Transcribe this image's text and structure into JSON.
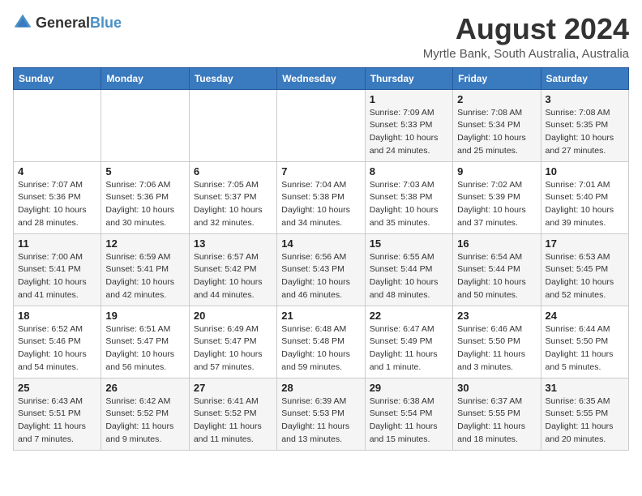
{
  "logo": {
    "general": "General",
    "blue": "Blue"
  },
  "title": "August 2024",
  "subtitle": "Myrtle Bank, South Australia, Australia",
  "days_header": [
    "Sunday",
    "Monday",
    "Tuesday",
    "Wednesday",
    "Thursday",
    "Friday",
    "Saturday"
  ],
  "weeks": [
    [
      {
        "day": "",
        "info": ""
      },
      {
        "day": "",
        "info": ""
      },
      {
        "day": "",
        "info": ""
      },
      {
        "day": "",
        "info": ""
      },
      {
        "day": "1",
        "info": "Sunrise: 7:09 AM\nSunset: 5:33 PM\nDaylight: 10 hours\nand 24 minutes."
      },
      {
        "day": "2",
        "info": "Sunrise: 7:08 AM\nSunset: 5:34 PM\nDaylight: 10 hours\nand 25 minutes."
      },
      {
        "day": "3",
        "info": "Sunrise: 7:08 AM\nSunset: 5:35 PM\nDaylight: 10 hours\nand 27 minutes."
      }
    ],
    [
      {
        "day": "4",
        "info": "Sunrise: 7:07 AM\nSunset: 5:36 PM\nDaylight: 10 hours\nand 28 minutes."
      },
      {
        "day": "5",
        "info": "Sunrise: 7:06 AM\nSunset: 5:36 PM\nDaylight: 10 hours\nand 30 minutes."
      },
      {
        "day": "6",
        "info": "Sunrise: 7:05 AM\nSunset: 5:37 PM\nDaylight: 10 hours\nand 32 minutes."
      },
      {
        "day": "7",
        "info": "Sunrise: 7:04 AM\nSunset: 5:38 PM\nDaylight: 10 hours\nand 34 minutes."
      },
      {
        "day": "8",
        "info": "Sunrise: 7:03 AM\nSunset: 5:38 PM\nDaylight: 10 hours\nand 35 minutes."
      },
      {
        "day": "9",
        "info": "Sunrise: 7:02 AM\nSunset: 5:39 PM\nDaylight: 10 hours\nand 37 minutes."
      },
      {
        "day": "10",
        "info": "Sunrise: 7:01 AM\nSunset: 5:40 PM\nDaylight: 10 hours\nand 39 minutes."
      }
    ],
    [
      {
        "day": "11",
        "info": "Sunrise: 7:00 AM\nSunset: 5:41 PM\nDaylight: 10 hours\nand 41 minutes."
      },
      {
        "day": "12",
        "info": "Sunrise: 6:59 AM\nSunset: 5:41 PM\nDaylight: 10 hours\nand 42 minutes."
      },
      {
        "day": "13",
        "info": "Sunrise: 6:57 AM\nSunset: 5:42 PM\nDaylight: 10 hours\nand 44 minutes."
      },
      {
        "day": "14",
        "info": "Sunrise: 6:56 AM\nSunset: 5:43 PM\nDaylight: 10 hours\nand 46 minutes."
      },
      {
        "day": "15",
        "info": "Sunrise: 6:55 AM\nSunset: 5:44 PM\nDaylight: 10 hours\nand 48 minutes."
      },
      {
        "day": "16",
        "info": "Sunrise: 6:54 AM\nSunset: 5:44 PM\nDaylight: 10 hours\nand 50 minutes."
      },
      {
        "day": "17",
        "info": "Sunrise: 6:53 AM\nSunset: 5:45 PM\nDaylight: 10 hours\nand 52 minutes."
      }
    ],
    [
      {
        "day": "18",
        "info": "Sunrise: 6:52 AM\nSunset: 5:46 PM\nDaylight: 10 hours\nand 54 minutes."
      },
      {
        "day": "19",
        "info": "Sunrise: 6:51 AM\nSunset: 5:47 PM\nDaylight: 10 hours\nand 56 minutes."
      },
      {
        "day": "20",
        "info": "Sunrise: 6:49 AM\nSunset: 5:47 PM\nDaylight: 10 hours\nand 57 minutes."
      },
      {
        "day": "21",
        "info": "Sunrise: 6:48 AM\nSunset: 5:48 PM\nDaylight: 10 hours\nand 59 minutes."
      },
      {
        "day": "22",
        "info": "Sunrise: 6:47 AM\nSunset: 5:49 PM\nDaylight: 11 hours\nand 1 minute."
      },
      {
        "day": "23",
        "info": "Sunrise: 6:46 AM\nSunset: 5:50 PM\nDaylight: 11 hours\nand 3 minutes."
      },
      {
        "day": "24",
        "info": "Sunrise: 6:44 AM\nSunset: 5:50 PM\nDaylight: 11 hours\nand 5 minutes."
      }
    ],
    [
      {
        "day": "25",
        "info": "Sunrise: 6:43 AM\nSunset: 5:51 PM\nDaylight: 11 hours\nand 7 minutes."
      },
      {
        "day": "26",
        "info": "Sunrise: 6:42 AM\nSunset: 5:52 PM\nDaylight: 11 hours\nand 9 minutes."
      },
      {
        "day": "27",
        "info": "Sunrise: 6:41 AM\nSunset: 5:52 PM\nDaylight: 11 hours\nand 11 minutes."
      },
      {
        "day": "28",
        "info": "Sunrise: 6:39 AM\nSunset: 5:53 PM\nDaylight: 11 hours\nand 13 minutes."
      },
      {
        "day": "29",
        "info": "Sunrise: 6:38 AM\nSunset: 5:54 PM\nDaylight: 11 hours\nand 15 minutes."
      },
      {
        "day": "30",
        "info": "Sunrise: 6:37 AM\nSunset: 5:55 PM\nDaylight: 11 hours\nand 18 minutes."
      },
      {
        "day": "31",
        "info": "Sunrise: 6:35 AM\nSunset: 5:55 PM\nDaylight: 11 hours\nand 20 minutes."
      }
    ]
  ]
}
